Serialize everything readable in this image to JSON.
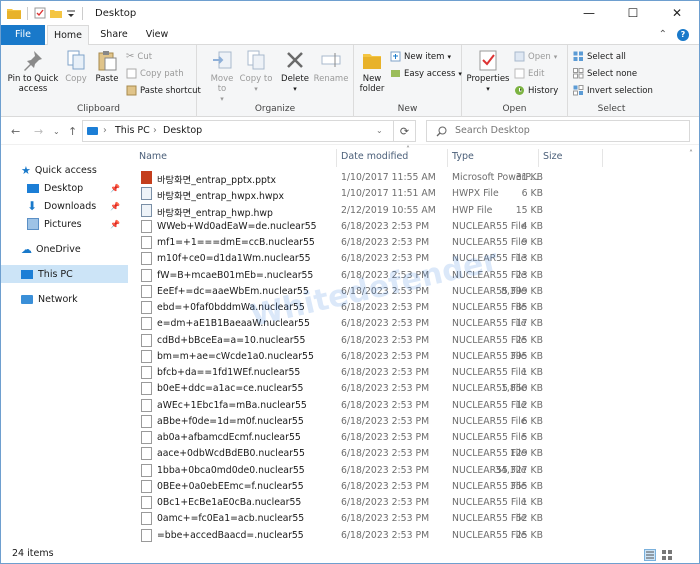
{
  "window": {
    "title": "Desktop",
    "minimize": "—",
    "maximize": "☐",
    "close": "✕"
  },
  "ribbon_tabs": {
    "file": "File",
    "home": "Home",
    "share": "Share",
    "view": "View"
  },
  "ribbon": {
    "clipboard": {
      "label": "Clipboard",
      "pin_quick_access": "Pin to Quick access",
      "copy": "Copy",
      "paste": "Paste",
      "cut": "Cut",
      "copy_path": "Copy path",
      "paste_shortcut": "Paste shortcut"
    },
    "organize": {
      "label": "Organize",
      "move_to": "Move to",
      "copy_to": "Copy to",
      "delete": "Delete",
      "rename": "Rename"
    },
    "new": {
      "label": "New",
      "new_folder": "New folder",
      "new_item": "New item",
      "easy_access": "Easy access"
    },
    "open": {
      "label": "Open",
      "properties": "Properties",
      "open": "Open",
      "edit": "Edit",
      "history": "History"
    },
    "select": {
      "label": "Select",
      "select_all": "Select all",
      "select_none": "Select none",
      "invert": "Invert selection"
    }
  },
  "address": {
    "this_pc": "This PC",
    "desktop": "Desktop",
    "search_placeholder": "Search Desktop"
  },
  "nav": {
    "quick_access": "Quick access",
    "desktop": "Desktop",
    "downloads": "Downloads",
    "pictures": "Pictures",
    "onedrive": "OneDrive",
    "this_pc": "This PC",
    "network": "Network"
  },
  "columns": {
    "name": "Name",
    "date": "Date modified",
    "type": "Type",
    "size": "Size"
  },
  "files": [
    {
      "name": "바탕화면_entrap_pptx.pptx",
      "date": "1/10/2017 11:55 AM",
      "type": "Microsoft PowerP...",
      "size": "31 KB",
      "icon": "ppt"
    },
    {
      "name": "바탕화면_entrap_hwpx.hwpx",
      "date": "1/10/2017 11:51 AM",
      "type": "HWPX File",
      "size": "6 KB",
      "icon": "hwp"
    },
    {
      "name": "바탕화면_entrap_hwp.hwp",
      "date": "2/12/2019 10:55 AM",
      "type": "HWP File",
      "size": "15 KB",
      "icon": "hwp"
    },
    {
      "name": "WWeb+Wd0adEaW=de.nuclear55",
      "date": "6/18/2023 2:53 PM",
      "type": "NUCLEAR55 File",
      "size": "4 KB",
      "icon": "doc"
    },
    {
      "name": "mf1=+1===dmE=ccB.nuclear55",
      "date": "6/18/2023 2:53 PM",
      "type": "NUCLEAR55 File",
      "size": "9 KB",
      "icon": "doc"
    },
    {
      "name": "m10f+ce0=d1da1Wm.nuclear55",
      "date": "6/18/2023 2:53 PM",
      "type": "NUCLEAR55 File",
      "size": "13 KB",
      "icon": "doc"
    },
    {
      "name": "fW=B+mcaeB01mEb=.nuclear55",
      "date": "6/18/2023 2:53 PM",
      "type": "NUCLEAR55 File",
      "size": "23 KB",
      "icon": "doc"
    },
    {
      "name": "EeEf+=dc=aaeWbEm.nuclear55",
      "date": "6/18/2023 2:53 PM",
      "type": "NUCLEAR55 File",
      "size": "8,399 KB",
      "icon": "doc"
    },
    {
      "name": "ebd=+0faf0bddmWa.nuclear55",
      "date": "6/18/2023 2:53 PM",
      "type": "NUCLEAR55 File",
      "size": "85 KB",
      "icon": "doc"
    },
    {
      "name": "e=dm+aE1B1BaeaaW.nuclear55",
      "date": "6/18/2023 2:53 PM",
      "type": "NUCLEAR55 File",
      "size": "17 KB",
      "icon": "doc"
    },
    {
      "name": "cdBd+bBceEa=a=10.nuclear55",
      "date": "6/18/2023 2:53 PM",
      "type": "NUCLEAR55 File",
      "size": "25 KB",
      "icon": "doc"
    },
    {
      "name": "bm=m+ae=cWcde1a0.nuclear55",
      "date": "6/18/2023 2:53 PM",
      "type": "NUCLEAR55 File",
      "size": "395 KB",
      "icon": "doc"
    },
    {
      "name": "bfcb+da==1fd1WEf.nuclear55",
      "date": "6/18/2023 2:53 PM",
      "type": "NUCLEAR55 File",
      "size": "1 KB",
      "icon": "doc"
    },
    {
      "name": "b0eE+ddc=a1ac=ce.nuclear55",
      "date": "6/18/2023 2:53 PM",
      "type": "NUCLEAR55 File",
      "size": "1,850 KB",
      "icon": "doc"
    },
    {
      "name": "aWEc+1Ebc1fa=mBa.nuclear55",
      "date": "6/18/2023 2:53 PM",
      "type": "NUCLEAR55 File",
      "size": "12 KB",
      "icon": "doc"
    },
    {
      "name": "aBbe+f0de=1d=m0f.nuclear55",
      "date": "6/18/2023 2:53 PM",
      "type": "NUCLEAR55 File",
      "size": "6 KB",
      "icon": "doc"
    },
    {
      "name": "ab0a+afbamcdEcmf.nuclear55",
      "date": "6/18/2023 2:53 PM",
      "type": "NUCLEAR55 File",
      "size": "5 KB",
      "icon": "doc"
    },
    {
      "name": "aace+0dbWcdBdEB0.nuclear55",
      "date": "6/18/2023 2:53 PM",
      "type": "NUCLEAR55 File",
      "size": "129 KB",
      "icon": "doc"
    },
    {
      "name": "1bba+0bca0md0de0.nuclear55",
      "date": "6/18/2023 2:53 PM",
      "type": "NUCLEAR55 File",
      "size": "34,327 KB",
      "icon": "doc"
    },
    {
      "name": "0BEe+0a0ebEEmc=f.nuclear55",
      "date": "6/18/2023 2:53 PM",
      "type": "NUCLEAR55 File",
      "size": "355 KB",
      "icon": "doc"
    },
    {
      "name": "0Bc1+EcBe1aE0cBa.nuclear55",
      "date": "6/18/2023 2:53 PM",
      "type": "NUCLEAR55 File",
      "size": "1 KB",
      "icon": "doc"
    },
    {
      "name": "0amc+=fc0Ea1=acb.nuclear55",
      "date": "6/18/2023 2:53 PM",
      "type": "NUCLEAR55 File",
      "size": "52 KB",
      "icon": "doc"
    },
    {
      "name": "=bbe+accedBaacd=.nuclear55",
      "date": "6/18/2023 2:53 PM",
      "type": "NUCLEAR55 File",
      "size": "25 KB",
      "icon": "doc"
    }
  ],
  "status": {
    "items": "24 items"
  },
  "watermark": "Whitedefender",
  "colors": {
    "accent": "#1979ca",
    "selection": "#cce4f7",
    "folder": "#f4c542"
  }
}
